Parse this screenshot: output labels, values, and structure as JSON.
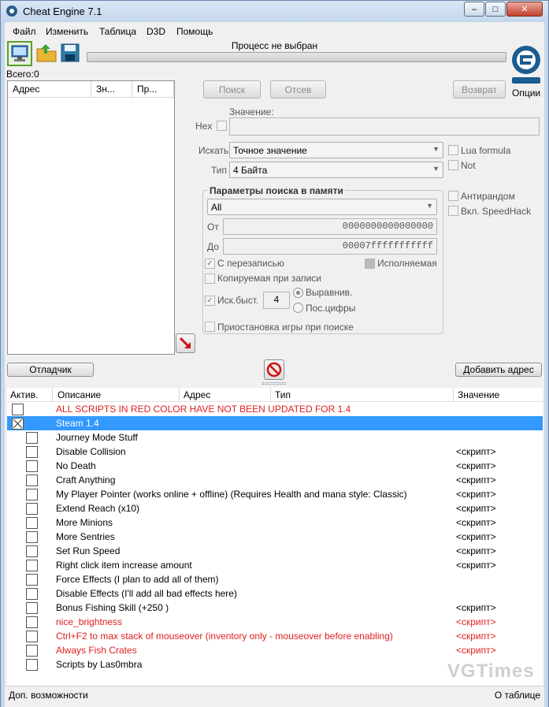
{
  "window": {
    "title": "Cheat Engine 7.1",
    "minimize_label": "–",
    "maximize_label": "□",
    "close_label": "✕"
  },
  "menu": [
    "Файл",
    "Изменить",
    "Таблица",
    "D3D",
    "Помощь"
  ],
  "toolbar": {
    "process_label": "Процесс не выбран",
    "total_label": "Всего:",
    "total_value": "0",
    "options_label": "Опции"
  },
  "found_list": {
    "columns": [
      "Адрес",
      "Зн...",
      "Пр..."
    ]
  },
  "scan": {
    "first_scan": "Поиск",
    "next_scan": "Отсев",
    "undo_scan": "Возврат",
    "value_label": "Значение:",
    "hex_label": "Hex",
    "scan_type_label": "Искать",
    "scan_type_value": "Точное значение",
    "value_type_label": "Тип",
    "value_type_value": "4 Байта",
    "lua_formula": "Lua formula",
    "not_label": "Not",
    "unrandomizer": "Антирандом",
    "speedhack": "Вкл. SpeedHack",
    "memory_group_title": "Параметры поиска в памяти",
    "memory_region": "All",
    "from_label": "От",
    "from_value": "0000000000000000",
    "to_label": "До",
    "to_value": "00007fffffffffff",
    "writable": "С перезаписью",
    "executable": "Исполняемая",
    "copy_on_write": "Копируемая при записи",
    "fast_scan": "Иск.быст.",
    "fast_scan_value": "4",
    "alignment": "Выравнив.",
    "last_digits": "Пос.цифры",
    "pause_game": "Приостановка игры при поиске"
  },
  "actions": {
    "debugger": "Отладчик",
    "add_address": "Добавить адрес"
  },
  "cheat_table": {
    "columns": [
      "Актив.",
      "Описание",
      "Адрес",
      "Тип",
      "Значение"
    ],
    "rows": [
      {
        "desc": "ALL SCRIPTS IN RED COLOR HAVE NOT BEEN UPDATED FOR 1.4",
        "value": "",
        "red": true,
        "indent": 0,
        "selected": false
      },
      {
        "desc": "Steam 1.4",
        "value": "",
        "red": false,
        "indent": 0,
        "selected": true
      },
      {
        "desc": "Journey Mode Stuff",
        "value": "",
        "red": false,
        "indent": 1,
        "selected": false
      },
      {
        "desc": "Disable Collision",
        "value": "<скрипт>",
        "red": false,
        "indent": 1,
        "selected": false
      },
      {
        "desc": "No Death",
        "value": "<скрипт>",
        "red": false,
        "indent": 1,
        "selected": false
      },
      {
        "desc": "Craft Anything",
        "value": "<скрипт>",
        "red": false,
        "indent": 1,
        "selected": false
      },
      {
        "desc": "My Player Pointer (works online + offline) (Requires Health and mana style: Classic)",
        "value": "<скрипт>",
        "red": false,
        "indent": 1,
        "selected": false
      },
      {
        "desc": "Extend Reach (x10)",
        "value": "<скрипт>",
        "red": false,
        "indent": 1,
        "selected": false
      },
      {
        "desc": "More Minions",
        "value": "<скрипт>",
        "red": false,
        "indent": 1,
        "selected": false
      },
      {
        "desc": "More Sentries",
        "value": "<скрипт>",
        "red": false,
        "indent": 1,
        "selected": false
      },
      {
        "desc": "Set Run Speed",
        "value": "<скрипт>",
        "red": false,
        "indent": 1,
        "selected": false
      },
      {
        "desc": "Right click item increase amount",
        "value": "<скрипт>",
        "red": false,
        "indent": 1,
        "selected": false
      },
      {
        "desc": "Force Effects (I plan to add all of them)",
        "value": "",
        "red": false,
        "indent": 1,
        "selected": false
      },
      {
        "desc": "Disable Effects (I'll add all bad effects here)",
        "value": "",
        "red": false,
        "indent": 1,
        "selected": false
      },
      {
        "desc": "Bonus Fishing Skill (+250 )",
        "value": "<скрипт>",
        "red": false,
        "indent": 1,
        "selected": false
      },
      {
        "desc": "nice_brightness",
        "value": "<скрипт>",
        "red": true,
        "indent": 1,
        "selected": false
      },
      {
        "desc": "Ctrl+F2 to max stack of mouseover (inventory only - mouseover before enabling)",
        "value": "<скрипт>",
        "red": true,
        "indent": 1,
        "selected": false
      },
      {
        "desc": "Always Fish Crates",
        "value": "<скрипт>",
        "red": true,
        "indent": 1,
        "selected": false
      },
      {
        "desc": "Scripts by Las0mbra",
        "value": "",
        "red": false,
        "indent": 1,
        "selected": false
      }
    ]
  },
  "status": {
    "left": "Доп. возможности",
    "right": "О таблице"
  },
  "watermark": "VGTimes"
}
